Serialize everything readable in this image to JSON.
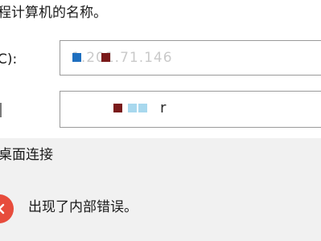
{
  "dialog": {
    "instruction": "程计算机的名称。",
    "computer_label": "C):",
    "computer_value": "1.201.71.146",
    "user_value": "r"
  },
  "status": {
    "title": "桌面连接",
    "message": "出现了内部错误。",
    "icon": "close-icon",
    "accent_color": "#e74c3c"
  }
}
